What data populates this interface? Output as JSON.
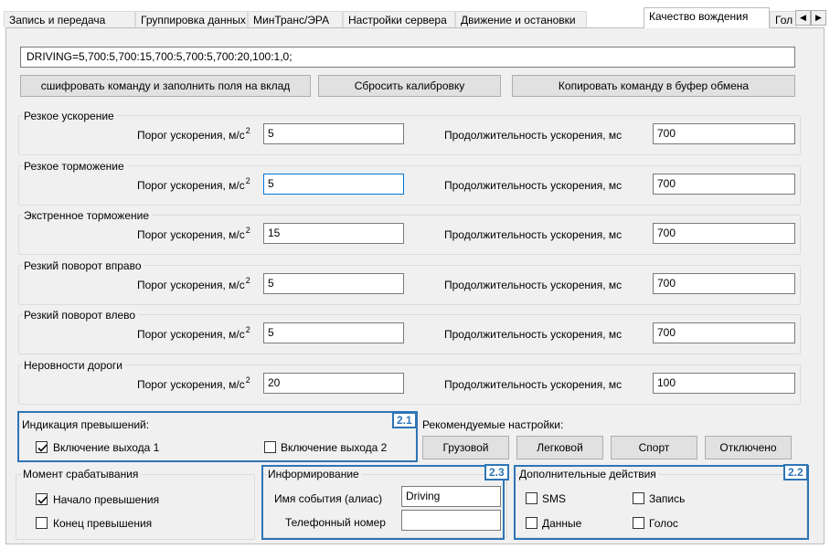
{
  "tabs": [
    {
      "label": "Запись и передача"
    },
    {
      "label": "Группировка данных"
    },
    {
      "label": "МинТранс/ЭРА"
    },
    {
      "label": "Настройки сервера"
    },
    {
      "label": "Движение и остановки"
    },
    {
      "label": "Качество вождения"
    },
    {
      "label": "Гол"
    }
  ],
  "command": {
    "value": "DRIVING=5,700:5,700:15,700:5,700:5,700:20,100:1,0;"
  },
  "buttons": {
    "decode": "сшифровать команду и заполнить поля на вклад",
    "reset": "Сбросить калибровку",
    "copy": "Копировать команду в буфер обмена"
  },
  "params": {
    "threshold_label": "Порог ускорения, м/с",
    "threshold_sup": "2",
    "duration_label": "Продолжительность ускорения, мс",
    "groups": [
      {
        "title": "Резкое ускорение",
        "threshold": "5",
        "duration": "700"
      },
      {
        "title": "Резкое торможение",
        "threshold": "5",
        "duration": "700"
      },
      {
        "title": "Экстренное торможение",
        "threshold": "15",
        "duration": "700"
      },
      {
        "title": "Резкий поворот вправо",
        "threshold": "5",
        "duration": "700"
      },
      {
        "title": "Резкий поворот влево",
        "threshold": "5",
        "duration": "700"
      },
      {
        "title": "Неровности дороги",
        "threshold": "20",
        "duration": "100"
      }
    ]
  },
  "indication": {
    "title": "Индикация превышений:",
    "out1": {
      "label": "Включение выхода 1",
      "checked": true
    },
    "out2": {
      "label": "Включение выхода 2",
      "checked": false
    },
    "tag": "2.1"
  },
  "recommended": {
    "title": "Рекомендуемые настройки:",
    "buttons": [
      "Грузовой",
      "Легковой",
      "Спорт",
      "Отключено"
    ]
  },
  "trigger": {
    "title": "Момент срабатывания",
    "start": {
      "label": "Начало превышения",
      "checked": true
    },
    "end": {
      "label": "Конец превышения",
      "checked": false
    }
  },
  "inform": {
    "title": "Информирование",
    "event_label": "Имя события (алиас)",
    "event_value": "Driving",
    "phone_label": "Телефонный номер",
    "phone_value": "",
    "tag": "2.3"
  },
  "extra": {
    "title": "Дополнительные действия",
    "sms": {
      "label": "SMS",
      "checked": false
    },
    "record": {
      "label": "Запись",
      "checked": false
    },
    "data": {
      "label": "Данные",
      "checked": false
    },
    "voice": {
      "label": "Голос",
      "checked": false
    },
    "tag": "2.2"
  },
  "colors": {
    "callout": "#2e75b6",
    "focus": "#0078d7"
  }
}
